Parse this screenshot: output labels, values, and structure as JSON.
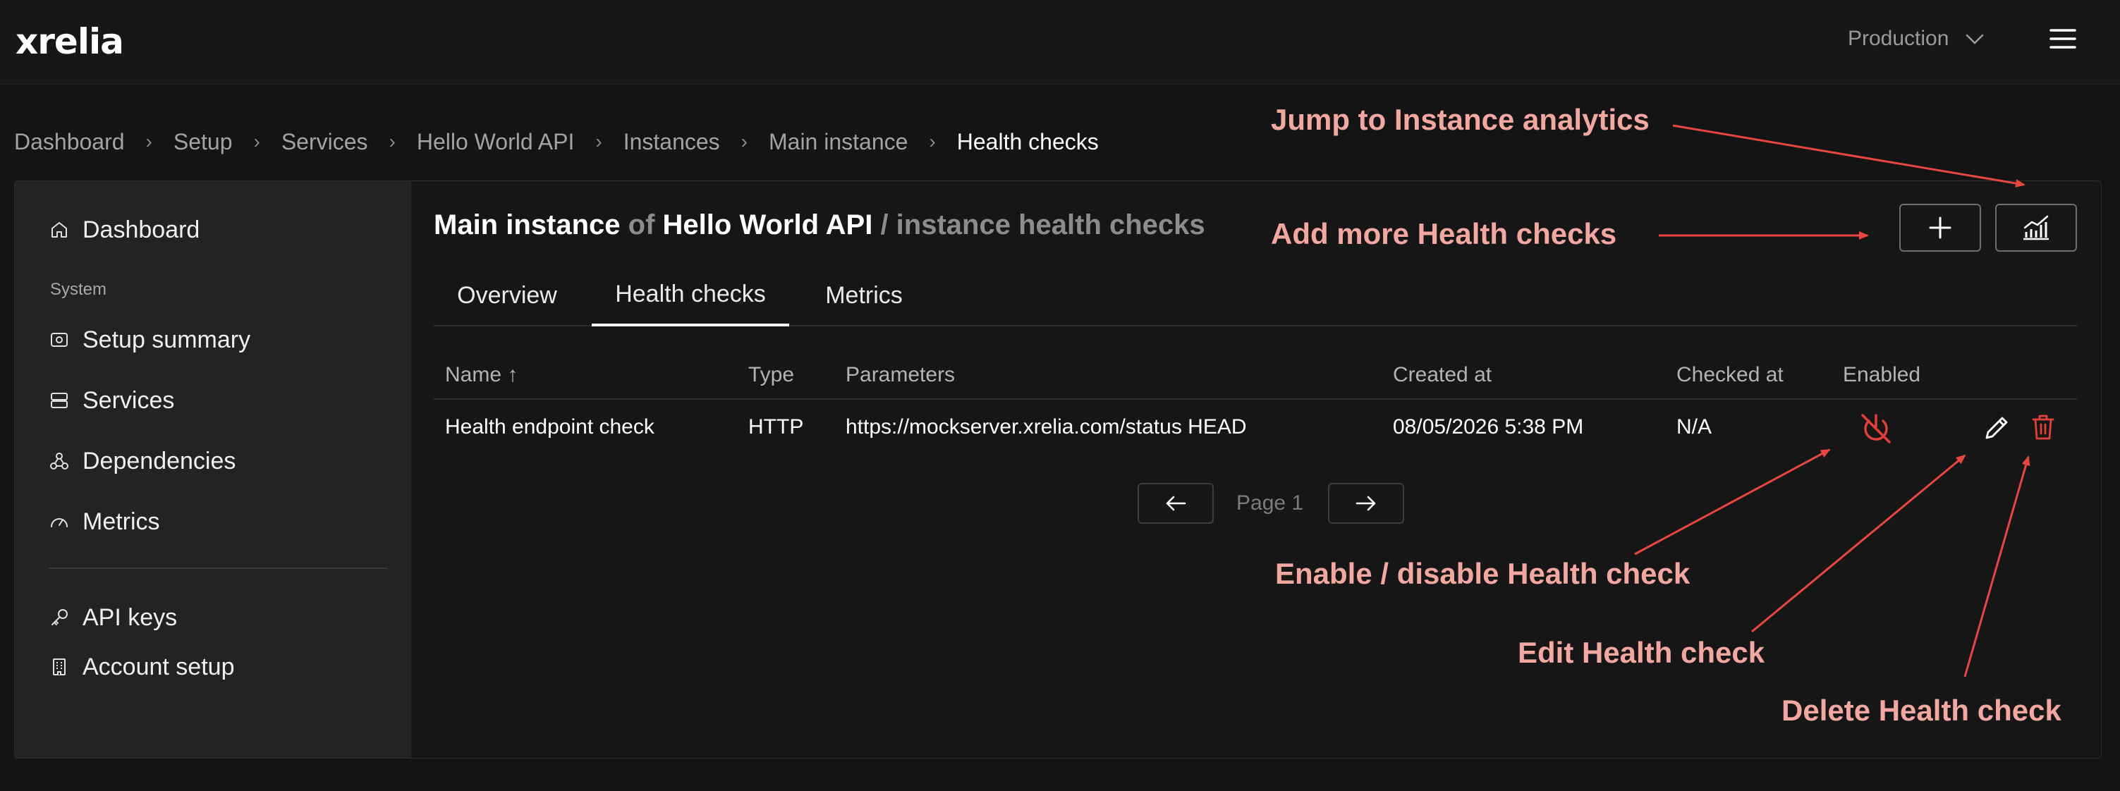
{
  "header": {
    "logo_text": "xrelia",
    "environment": "Production"
  },
  "breadcrumb": {
    "items": [
      "Dashboard",
      "Setup",
      "Services",
      "Hello World API",
      "Instances",
      "Main instance",
      "Health checks"
    ],
    "separator": "›"
  },
  "sidebar": {
    "dashboard": "Dashboard",
    "section_label": "System",
    "items": [
      "Setup summary",
      "Services",
      "Dependencies",
      "Metrics"
    ],
    "bottom_items": [
      "API keys",
      "Account setup"
    ]
  },
  "page": {
    "title_instance": "Main instance",
    "title_of": "of",
    "title_service": "Hello World API",
    "title_suffix": "/ instance health checks"
  },
  "tabs": [
    "Overview",
    "Health checks",
    "Metrics"
  ],
  "active_tab": "Health checks",
  "table": {
    "columns": [
      "Name",
      "Type",
      "Parameters",
      "Created at",
      "Checked at",
      "Enabled"
    ],
    "sort_indicator": "↑",
    "rows": [
      {
        "name": "Health endpoint check",
        "type": "HTTP",
        "parameters": "https://mockserver.xrelia.com/status HEAD",
        "created_at": "08/05/2026 5:38 PM",
        "checked_at": "N/A",
        "enabled": false
      }
    ]
  },
  "pagination": {
    "label": "Page 1"
  },
  "annotations": {
    "analytics": "Jump to Instance analytics",
    "add": "Add more Health checks",
    "toggle": "Enable / disable Health check",
    "edit": "Edit Health check",
    "delete": "Delete Health check"
  },
  "colors": {
    "background": "#141414",
    "sidebar": "#232323",
    "annotation_text": "#f2a7a0",
    "annotation_arrow": "#e8473f",
    "danger": "#e2403a"
  },
  "icons": [
    "home-icon",
    "setup-summary-icon",
    "services-icon",
    "dependencies-icon",
    "metrics-icon",
    "key-icon",
    "building-icon",
    "plus-icon",
    "analytics-icon",
    "power-off-icon",
    "pencil-icon",
    "trash-icon",
    "arrow-left-icon",
    "arrow-right-icon",
    "chevron-down-icon",
    "menu-icon"
  ]
}
